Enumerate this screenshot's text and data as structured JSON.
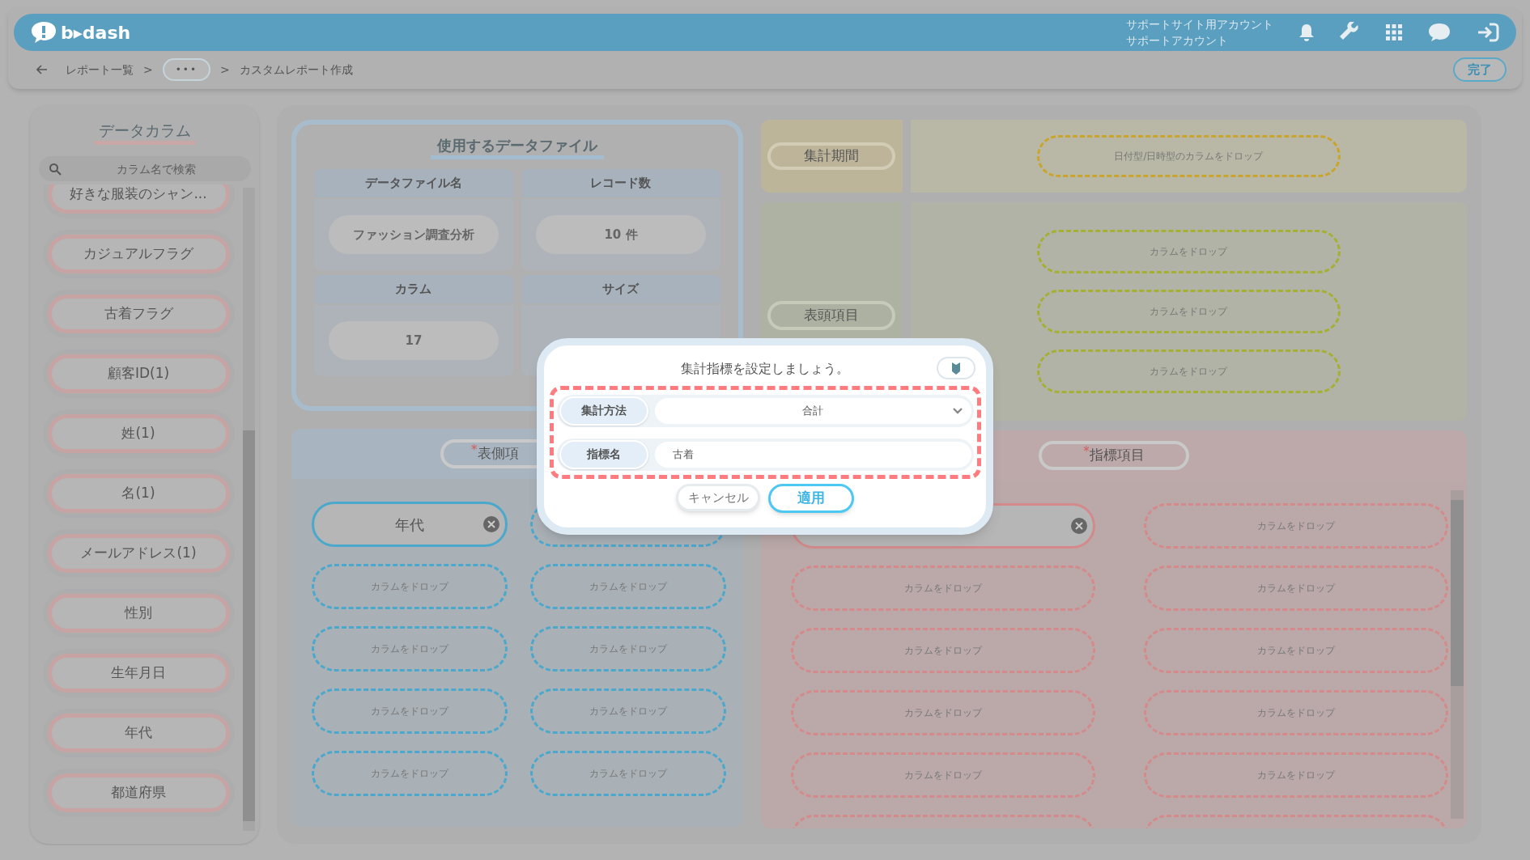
{
  "header": {
    "logo": "b▸dash",
    "account_lines": [
      "サポートサイト用アカウント",
      "サポートアカウント"
    ]
  },
  "breadcrumb": [
    {
      "kind": "link",
      "label": "レポート一覧"
    },
    {
      "kind": "separator",
      "label": ">"
    },
    {
      "kind": "more",
      "label": "•••"
    },
    {
      "kind": "separator",
      "label": ">"
    },
    {
      "kind": "current",
      "label": "カスタムレポート作成"
    }
  ],
  "done_button": "完了",
  "sidebar": {
    "title": "データカラム",
    "search": {
      "placeholder": "カラム名で検索"
    },
    "items": [
      "好きな服装のシャン...",
      "カジュアルフラグ",
      "古着フラグ",
      "顧客ID(1)",
      "姓(1)",
      "名(1)",
      "メールアドレス(1)",
      "性別",
      "生年月日",
      "年代",
      "都道府県"
    ]
  },
  "data_file": {
    "title": "使用するデータファイル",
    "cells": [
      {
        "label": "データファイル名",
        "value": "ファッション調査分析"
      },
      {
        "label": "レコード数",
        "value": "10 件"
      },
      {
        "label": "カラム",
        "value": "17"
      },
      {
        "label": "サイズ"
      }
    ]
  },
  "period": {
    "label": "集計期間",
    "drop_zones": [
      "日付型/日時型のカラムをドロップ"
    ]
  },
  "column_header": {
    "label": "表頭項目",
    "drop_zones": [
      "カラムをドロップ",
      "カラムをドロップ",
      "カラムをドロップ"
    ]
  },
  "row_side": {
    "label": "表側項",
    "required_mark": "*",
    "cells": [
      {
        "kind": "chip",
        "label": "年代"
      },
      {
        "kind": "drop"
      },
      {
        "kind": "drop",
        "label": "カラムをドロップ"
      },
      {
        "kind": "drop",
        "label": "カラムをドロップ"
      },
      {
        "kind": "drop",
        "label": "カラムをドロップ"
      },
      {
        "kind": "drop",
        "label": "カラムをドロップ"
      },
      {
        "kind": "drop",
        "label": "カラムをドロップ"
      },
      {
        "kind": "drop",
        "label": "カラムをドロップ"
      },
      {
        "kind": "drop",
        "label": "カラムをドロップ"
      },
      {
        "kind": "drop",
        "label": "カラムをドロップ"
      }
    ]
  },
  "metrics": {
    "label": "指標項目",
    "required_mark": "*",
    "cells": [
      {
        "kind": "chip"
      },
      {
        "kind": "drop",
        "label": "カラムをドロップ"
      },
      {
        "kind": "drop",
        "label": "カラムをドロップ"
      },
      {
        "kind": "drop",
        "label": "カラムをドロップ"
      },
      {
        "kind": "drop",
        "label": "カラムをドロップ"
      },
      {
        "kind": "drop",
        "label": "カラムをドロップ"
      },
      {
        "kind": "drop",
        "label": "カラムをドロップ"
      },
      {
        "kind": "drop",
        "label": "カラムをドロップ"
      },
      {
        "kind": "drop",
        "label": "カラムをドロップ"
      },
      {
        "kind": "drop",
        "label": "カラムをドロップ"
      },
      {
        "kind": "drop"
      },
      {
        "kind": "drop"
      }
    ]
  },
  "modal": {
    "title": "集計指標を設定しましょう。",
    "fields": [
      {
        "kind": "select",
        "label": "集計方法",
        "value": "合計"
      },
      {
        "kind": "input",
        "label": "指標名",
        "value": "古着"
      }
    ],
    "buttons": [
      {
        "kind": "secondary",
        "label": "キャンセル"
      },
      {
        "kind": "primary",
        "label": "適用"
      }
    ]
  }
}
